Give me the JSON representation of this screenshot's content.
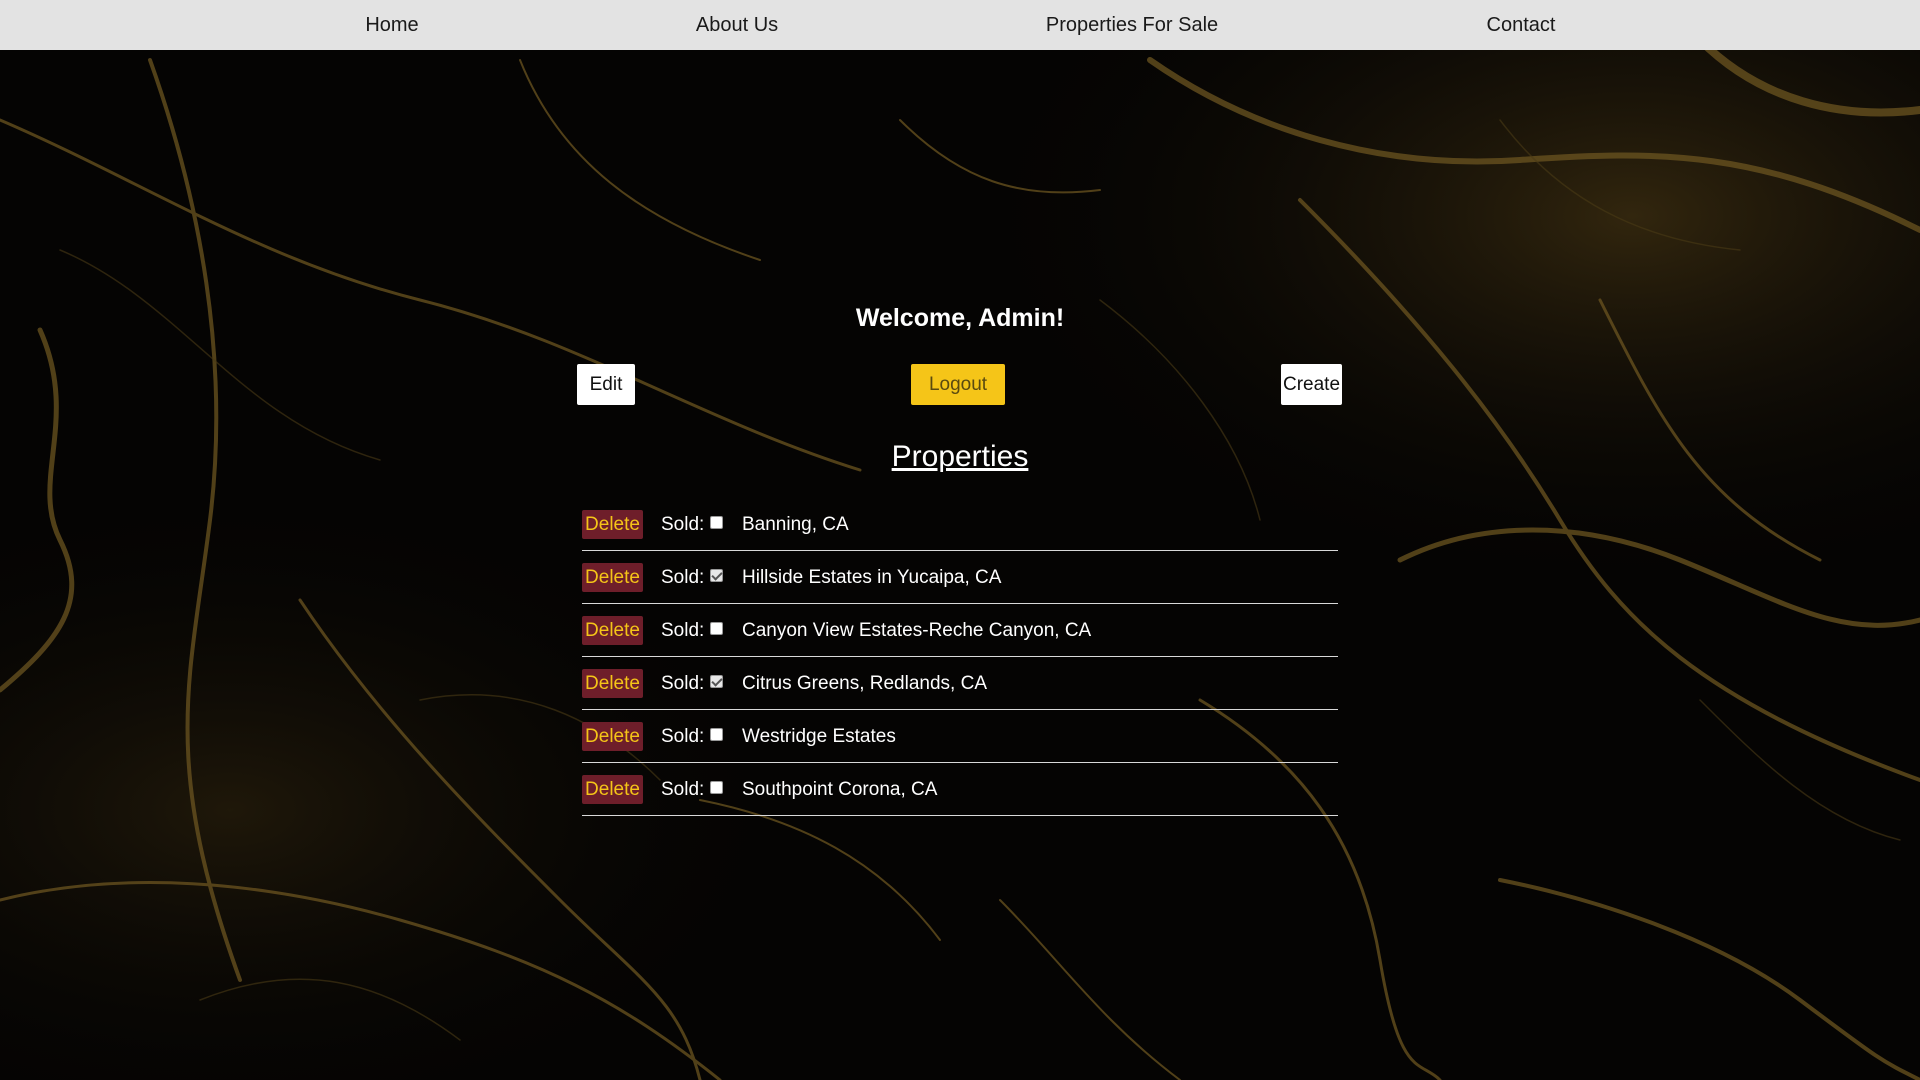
{
  "nav": {
    "items": [
      {
        "label": "Home"
      },
      {
        "label": "About Us"
      },
      {
        "label": "Properties For Sale"
      },
      {
        "label": "Contact"
      }
    ]
  },
  "welcome": "Welcome, Admin!",
  "actions": {
    "edit_label": "Edit",
    "logout_label": "Logout",
    "create_label": "Create"
  },
  "properties": {
    "heading": "Properties",
    "delete_label": "Delete",
    "sold_label": "Sold:",
    "items": [
      {
        "name": "Banning, CA",
        "sold": false
      },
      {
        "name": "Hillside Estates in Yucaipa, CA",
        "sold": true
      },
      {
        "name": "Canyon View Estates-Reche Canyon, CA",
        "sold": false
      },
      {
        "name": "Citrus Greens, Redlands, CA",
        "sold": true
      },
      {
        "name": "Westridge Estates",
        "sold": false
      },
      {
        "name": "Southpoint Corona, CA",
        "sold": false
      }
    ]
  },
  "colors": {
    "background": "#050403",
    "navbar": "#e3e3e3",
    "gold_accent": "#f5c518",
    "delete_bg": "#6e1e2a",
    "marble_vein": "#6b5420"
  }
}
